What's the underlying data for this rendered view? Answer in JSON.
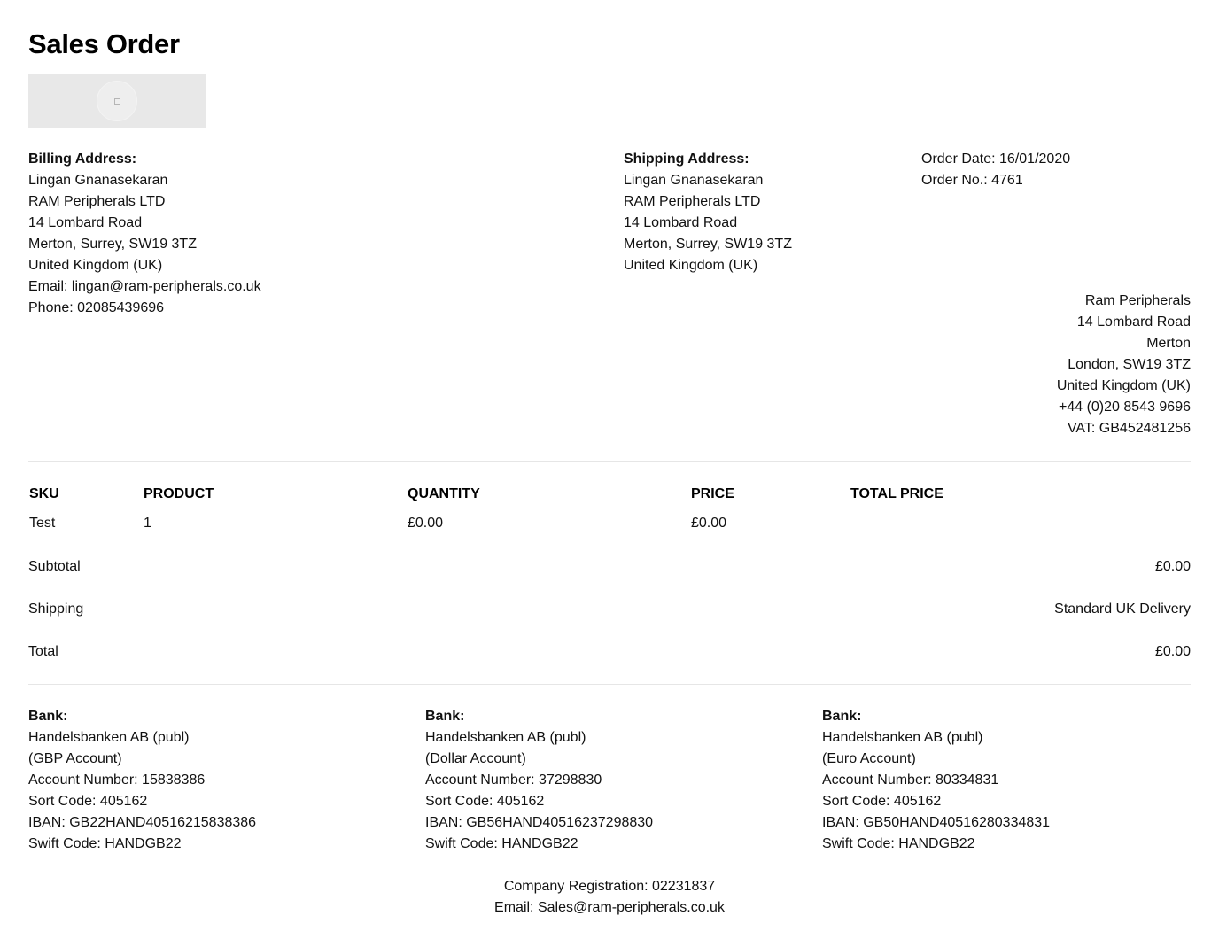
{
  "title": "Sales Order",
  "billing": {
    "heading": "Billing Address:",
    "lines": [
      "Lingan Gnanasekaran",
      "RAM Peripherals LTD",
      "14 Lombard Road",
      "Merton, Surrey, SW19 3TZ",
      "United Kingdom (UK)",
      "Email: lingan@ram-peripherals.co.uk",
      "Phone: 02085439696"
    ]
  },
  "shipping": {
    "heading": "Shipping Address:",
    "lines": [
      "Lingan Gnanasekaran",
      "RAM Peripherals LTD",
      "14 Lombard Road",
      "Merton, Surrey, SW19 3TZ",
      "United Kingdom (UK)"
    ]
  },
  "order": {
    "date": "Order Date: 16/01/2020",
    "number": "Order No.: 4761"
  },
  "company": {
    "lines": [
      "Ram Peripherals",
      "14 Lombard Road",
      "Merton",
      "London, SW19 3TZ",
      "United Kingdom (UK)",
      "+44 (0)20 8543 9696",
      "VAT: GB452481256"
    ]
  },
  "table": {
    "headers": {
      "sku": "SKU",
      "product": "PRODUCT",
      "quantity": "QUANTITY",
      "price": "PRICE",
      "total": "TOTAL PRICE"
    },
    "row": {
      "sku": "Test",
      "product": "1",
      "quantity": "£0.00",
      "price": "£0.00",
      "total": ""
    }
  },
  "summary": {
    "subtotal_label": "Subtotal",
    "subtotal_value": "£0.00",
    "shipping_label": "Shipping",
    "shipping_value": "Standard UK Delivery",
    "total_label": "Total",
    "total_value": "£0.00"
  },
  "banks": [
    {
      "heading": "Bank:",
      "lines": [
        "Handelsbanken AB (publ)",
        "(GBP Account)",
        "Account Number: 15838386",
        "Sort Code: 405162",
        "IBAN: GB22HAND40516215838386",
        "Swift Code: HANDGB22"
      ]
    },
    {
      "heading": "Bank:",
      "lines": [
        "Handelsbanken AB (publ)",
        "(Dollar Account)",
        "Account Number: 37298830",
        "Sort Code: 405162",
        "IBAN: GB56HAND40516237298830",
        "Swift Code: HANDGB22"
      ]
    },
    {
      "heading": "Bank:",
      "lines": [
        "Handelsbanken AB (publ)",
        "(Euro Account)",
        "Account Number: 80334831",
        "Sort Code: 405162",
        "IBAN: GB50HAND40516280334831",
        "Swift Code: HANDGB22"
      ]
    }
  ],
  "footer": {
    "registration": "Company Registration: 02231837",
    "email": "Email: Sales@ram-peripherals.co.uk"
  }
}
